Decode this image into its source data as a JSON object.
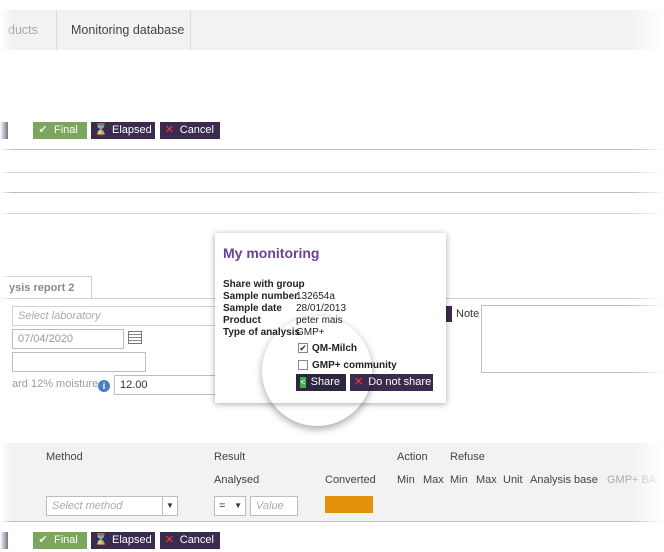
{
  "nav": {
    "tabs": [
      "ducts",
      "Monitoring database"
    ]
  },
  "toolbar": {
    "final": "Final",
    "elapsed": "Elapsed",
    "cancel": "Cancel"
  },
  "report": {
    "tab": "ysis report 2",
    "laboratory_placeholder": "Select laboratory",
    "date": "07/04/2020",
    "moisture_label": "ard 12% moisture",
    "moisture_value": "12.00",
    "note_label": "Note"
  },
  "popup": {
    "title": "My monitoring",
    "share_with_group": "Share with group",
    "sample_number_label": "Sample number",
    "sample_number": "132654a",
    "sample_date_label": "Sample date",
    "sample_date": "28/01/2013",
    "product_label": "Product",
    "product": "peter mais",
    "type_label": "Type of analysis",
    "type": "GMP+",
    "options": [
      {
        "label": "QM-Milch",
        "checked": true
      },
      {
        "label": "GMP+ community",
        "checked": false
      }
    ],
    "share_button": "Share",
    "not_share_button": "Do not share"
  },
  "table": {
    "method": "Method",
    "result": "Result",
    "action": "Action",
    "refuse": "Refuse",
    "analysed": "Analysed",
    "converted": "Converted",
    "min": "Min",
    "max": "Max",
    "unit": "Unit",
    "analysis_base": "Analysis base",
    "gmp_col": "GMP+ BA",
    "method_placeholder": "Select method",
    "operator": "=",
    "value_placeholder": "Value",
    "converted_color": "#e3900a"
  }
}
